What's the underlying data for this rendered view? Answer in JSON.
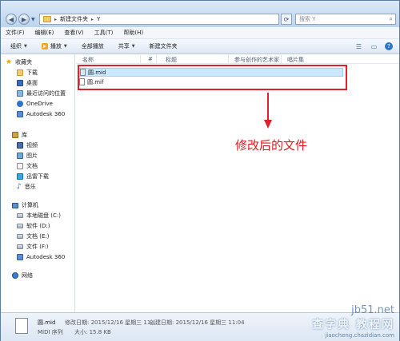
{
  "address": {
    "crumb_1": "新建文件夹",
    "crumb_2": "Y"
  },
  "search": {
    "placeholder": "搜索 Y"
  },
  "menu": [
    "文件(F)",
    "编辑(E)",
    "查看(V)",
    "工具(T)",
    "帮助(H)"
  ],
  "toolbar": {
    "organize": "组织",
    "play": "播放",
    "play_all": "全部播放",
    "share": "共享",
    "new_folder": "新建文件夹"
  },
  "sidebar": {
    "favorites": "收藏夹",
    "downloads": "下载",
    "desktop": "桌面",
    "recent": "最近访问的位置",
    "onedrive": "OneDrive",
    "autodesk1": "Autodesk 360",
    "libraries": "库",
    "videos": "视频",
    "pictures": "图片",
    "documents": "文档",
    "thunder": "迅雷下载",
    "music": "音乐",
    "computer": "计算机",
    "drive_c": "本地磁盘 (C:)",
    "drive_d": "软件 (D:)",
    "drive_e": "文档 (E:)",
    "drive_f": "文件 (F:)",
    "autodesk2": "Autodesk 360",
    "network": "网络"
  },
  "columns": {
    "name": "名称",
    "number": "#",
    "title": "标题",
    "artist": "参与创作的艺术家",
    "album": "唱片集"
  },
  "files": [
    {
      "name": "圆.mid",
      "type": "mid"
    },
    {
      "name": "圆.mif",
      "type": "mif"
    }
  ],
  "annotation": "修改后的文件",
  "details": {
    "name": "圆.mid",
    "type": "MIDI 序列",
    "modified": "修改日期: 2015/12/16 星期三 11...",
    "created": "创建日期: 2015/12/16 星期三 11:04",
    "size": "大小: 15.8 KB"
  },
  "watermark": {
    "site": "jb51.net",
    "title": "查字典 教程网",
    "url": "jiaocheng.chazidian.com"
  },
  "colors": {
    "accent_red": "#e0202a",
    "selection": "#cce8ff"
  }
}
